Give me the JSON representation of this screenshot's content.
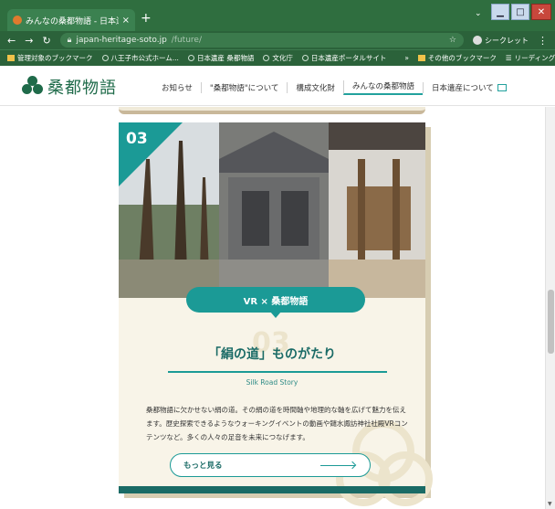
{
  "browser": {
    "tab_title": "みんなの桑都物語 - 日本遺産八王",
    "tab_close": "×",
    "new_tab": "+",
    "url_host": "japan-heritage-soto.jp",
    "url_path": "/future/",
    "incognito_label": "シークレット",
    "bookmarks": [
      "管理対象のブックマーク",
      "八王子市公式ホーム...",
      "日本遺産 桑都物語",
      "文化庁",
      "日本遺産ポータルサイト"
    ],
    "bookmarks_overflow": "»",
    "other_bookmarks": "その他のブックマーク",
    "reading_list": "リーディングリスト"
  },
  "site": {
    "logo_text": "桑都物語",
    "nav": [
      "お知らせ",
      "\"桑都物語\"について",
      "構成文化財",
      "みんなの桑都物語",
      "日本遺産について"
    ]
  },
  "card": {
    "number": "03",
    "pill_label": "VR × 桑都物語",
    "bg_number": "03",
    "title": "「絹の道」ものがたり",
    "subtitle": "Silk Road Story",
    "description": "桑都物語に欠かせない絹の道。その絹の道を時間軸や地理的な軸を広げて魅力を伝えます。歴史探索できるようなウォーキングイベントの動画や鑓水諏訪神社社殿VRコンテンツなど。多くの人々の足音を未来につなげます。",
    "more_label": "もっと見る"
  },
  "colors": {
    "brand_green": "#1f6b4a",
    "teal": "#1b9a96",
    "card_bg": "#f8f4e8",
    "chrome_green": "#2f6e3f"
  }
}
